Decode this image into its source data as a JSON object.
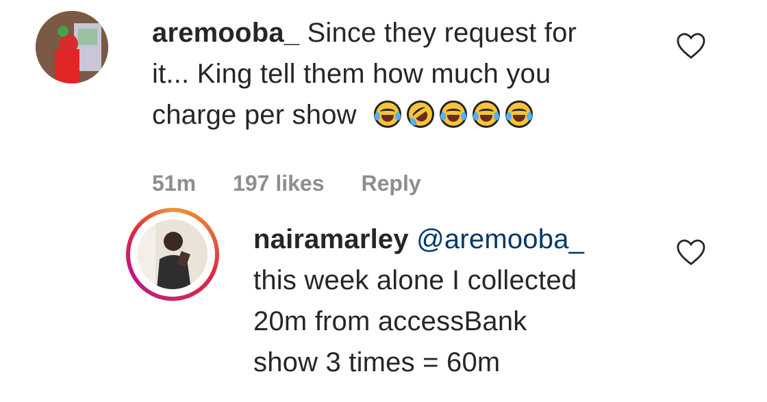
{
  "comments": [
    {
      "username": "aremooba_",
      "text_lines": [
        "Since they request for",
        "it... King tell them how much you",
        "charge per show"
      ],
      "emojis": [
        "face-with-tears-of-joy",
        "rolling-on-the-floor-laughing",
        "face-with-tears-of-joy",
        "face-with-tears-of-joy",
        "face-with-tears-of-joy"
      ],
      "meta": {
        "time": "51m",
        "likes": "197 likes",
        "reply": "Reply"
      },
      "like_icon": "heart-outline-icon"
    },
    {
      "username": "nairamarley",
      "mention": "@aremooba_",
      "text_lines": [
        "this week alone I collected",
        "20m from accessBank",
        "show 3 times = 60m"
      ],
      "like_icon": "heart-outline-icon",
      "avatar_ring_colors": [
        "#f09433",
        "#dc2743",
        "#bc1888"
      ]
    }
  ]
}
